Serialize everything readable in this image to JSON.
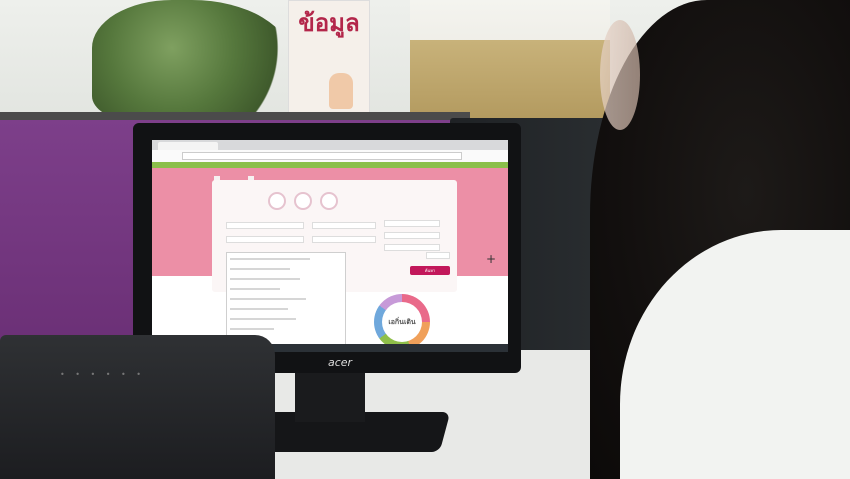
{
  "scene": {
    "poster_text": "ข้อมูล",
    "monitor_brand": "acer",
    "screen": {
      "browser_tab": "",
      "address": "",
      "search_button": "ค้นหา",
      "donut_label": "เอกิ่นเติน"
    }
  },
  "colors": {
    "partition": "#7d3f8a",
    "page_pink": "#ec8fa6",
    "search_button": "#c2185b"
  }
}
